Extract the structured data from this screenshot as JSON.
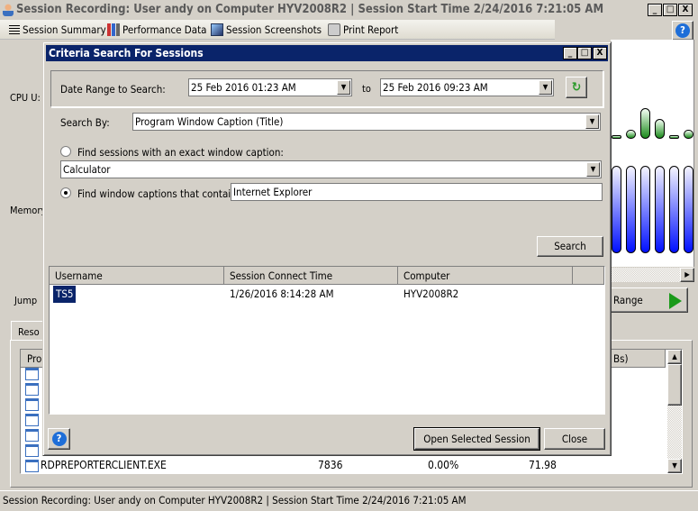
{
  "window": {
    "title": "Session Recording: User andy on Computer HYV2008R2 | Session Start Time 2/24/2016 7:21:05 AM",
    "minimize": "_",
    "maximize": "□",
    "close": "X"
  },
  "toolbar": {
    "items": [
      {
        "label": "Session Summary",
        "icon": "list-icon"
      },
      {
        "label": "Performance Data",
        "icon": "chart-icon"
      },
      {
        "label": "Session Screenshots",
        "icon": "picture-icon"
      },
      {
        "label": "Print Report",
        "icon": "printer-icon"
      }
    ],
    "help": "?"
  },
  "background": {
    "cpu_label": "CPU U:",
    "memory_label": "Memory",
    "jump_label": "Jump",
    "range_button": "Range",
    "tab_label": "Reso",
    "list_header_left": "Pro",
    "list_header_right": "Bs)",
    "last_row": {
      "name": "RDPREPORTERCLIENT.EXE",
      "pid": "7836",
      "cpu": "0.00%",
      "mem": "71.98"
    },
    "cpu_bar_levels": [
      0.1,
      0.25,
      0.85,
      0.55,
      0.05,
      0.25,
      0.1
    ],
    "memory_bar_levels": [
      1,
      1,
      1,
      1,
      1,
      1,
      1
    ],
    "colors": {
      "cpu": "#1a8a1a",
      "memory": "#0010ff"
    }
  },
  "dialog": {
    "title": "Criteria Search For Sessions",
    "date_label": "Date Range to Search:",
    "date_from": "25 Feb 2016 01:23 AM",
    "to_label": "to",
    "date_to": "25 Feb 2016 09:23 AM",
    "search_by_label": "Search By:",
    "search_by_value": "Program Window Caption (Title)",
    "exact_label": "Find sessions with an exact window caption:",
    "exact_value": "Calculator",
    "exact_selected": false,
    "contains_label": "Find window captions that contain:",
    "contains_value": "Internet Explorer",
    "contains_selected": true,
    "search_button": "Search",
    "columns": [
      "Username",
      "Session Connect Time",
      "Computer"
    ],
    "rows": [
      {
        "username": "TS5",
        "connect_time": "1/26/2016 8:14:28 AM",
        "computer": "HYV2008R2"
      }
    ],
    "open_button": "Open Selected Session",
    "close_button": "Close",
    "help": "?"
  },
  "status_bar": "Session Recording: User andy on Computer HYV2008R2 | Session Start Time 2/24/2016 7:21:05 AM"
}
